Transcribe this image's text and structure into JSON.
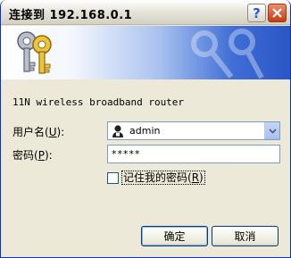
{
  "window": {
    "title": "连接到 192.168.0.1",
    "help_button": "?",
    "close_button": "X"
  },
  "description": "11N wireless broadband router",
  "form": {
    "username_label_pre": "用户名(",
    "username_label_key": "U",
    "username_label_post": "):",
    "username_value": "admin",
    "password_label_pre": "密码(",
    "password_label_key": "P",
    "password_label_post": "):",
    "password_value": "*****",
    "remember_pre": "记住我的密码(",
    "remember_key": "R",
    "remember_post": ")",
    "remember_checked": false
  },
  "buttons": {
    "ok": "确定",
    "cancel": "取消"
  },
  "colors": {
    "title_bar": "#d3d0c2",
    "banner_accent": "#2a55c5",
    "dialog_bg": "#ece9d8"
  },
  "icons": {
    "banner": "keys-icon",
    "user": "user-icon",
    "dropdown": "chevron-down-icon"
  }
}
